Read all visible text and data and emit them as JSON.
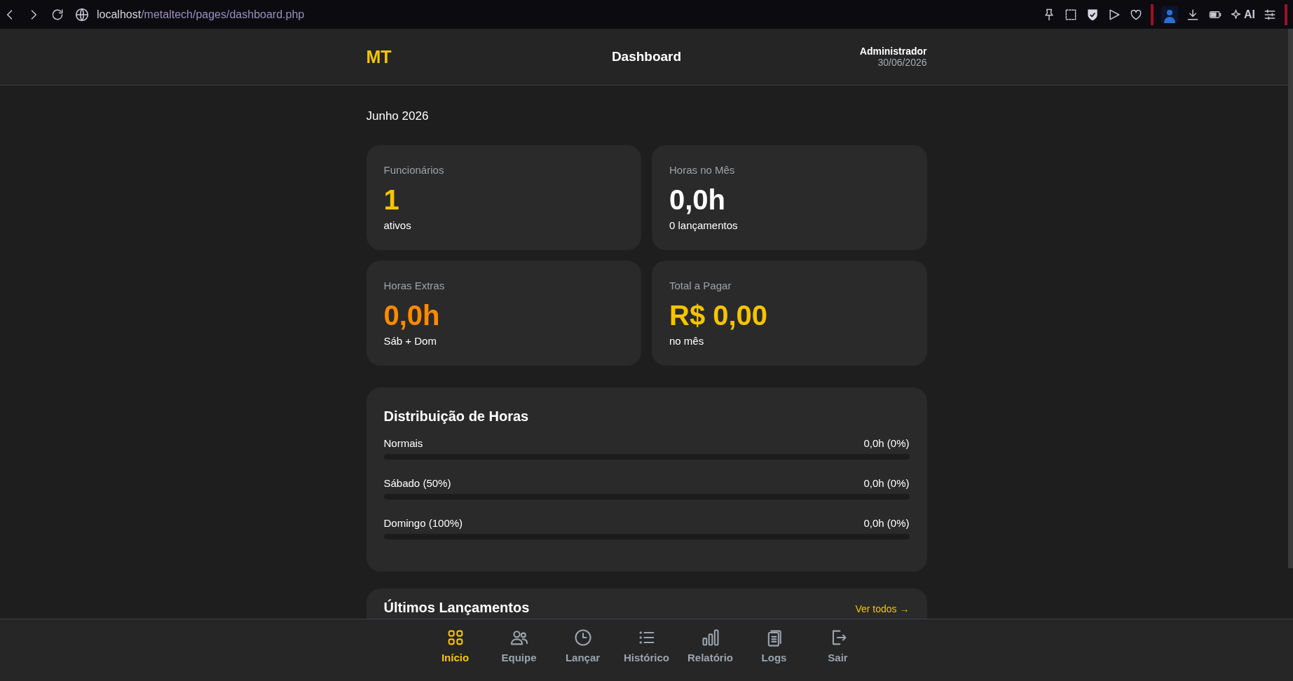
{
  "browser": {
    "url_host": "localhost",
    "url_path": "/metaltech/pages/dashboard.php",
    "ai_label": "AI"
  },
  "header": {
    "logo": "MT",
    "title": "Dashboard",
    "user": "Administrador",
    "date": "30/06/2026"
  },
  "period": "Junho 2026",
  "stats": [
    {
      "label": "Funcionários",
      "value": "1",
      "note": "ativos",
      "color": "#f5c400"
    },
    {
      "label": "Horas no Mês",
      "value": "0,0h",
      "note": "0 lançamentos",
      "color": "#ffffff"
    },
    {
      "label": "Horas Extras",
      "value": "0,0h",
      "note": "Sáb + Dom",
      "color": "#ff8a00"
    },
    {
      "label": "Total a Pagar",
      "value": "R$ 0,00",
      "note": "no mês",
      "color": "#f5c400"
    }
  ],
  "distribution": {
    "title": "Distribuição de Horas",
    "rows": [
      {
        "label": "Normais",
        "reading": "0,0h (0%)",
        "level": 0
      },
      {
        "label": "Sábado (50%)",
        "reading": "0,0h (0%)",
        "level": 0
      },
      {
        "label": "Domingo (100%)",
        "reading": "0,0h (0%)",
        "level": 0
      }
    ]
  },
  "recent": {
    "title": "Últimos Lançamentos",
    "link": "Ver todos →"
  },
  "nav": [
    {
      "label": "Início",
      "selected": true
    },
    {
      "label": "Equipe",
      "selected": false
    },
    {
      "label": "Lançar",
      "selected": false
    },
    {
      "label": "Histórico",
      "selected": false
    },
    {
      "label": "Relatório",
      "selected": false
    },
    {
      "label": "Logs",
      "selected": false
    },
    {
      "label": "Sair",
      "selected": false
    }
  ]
}
